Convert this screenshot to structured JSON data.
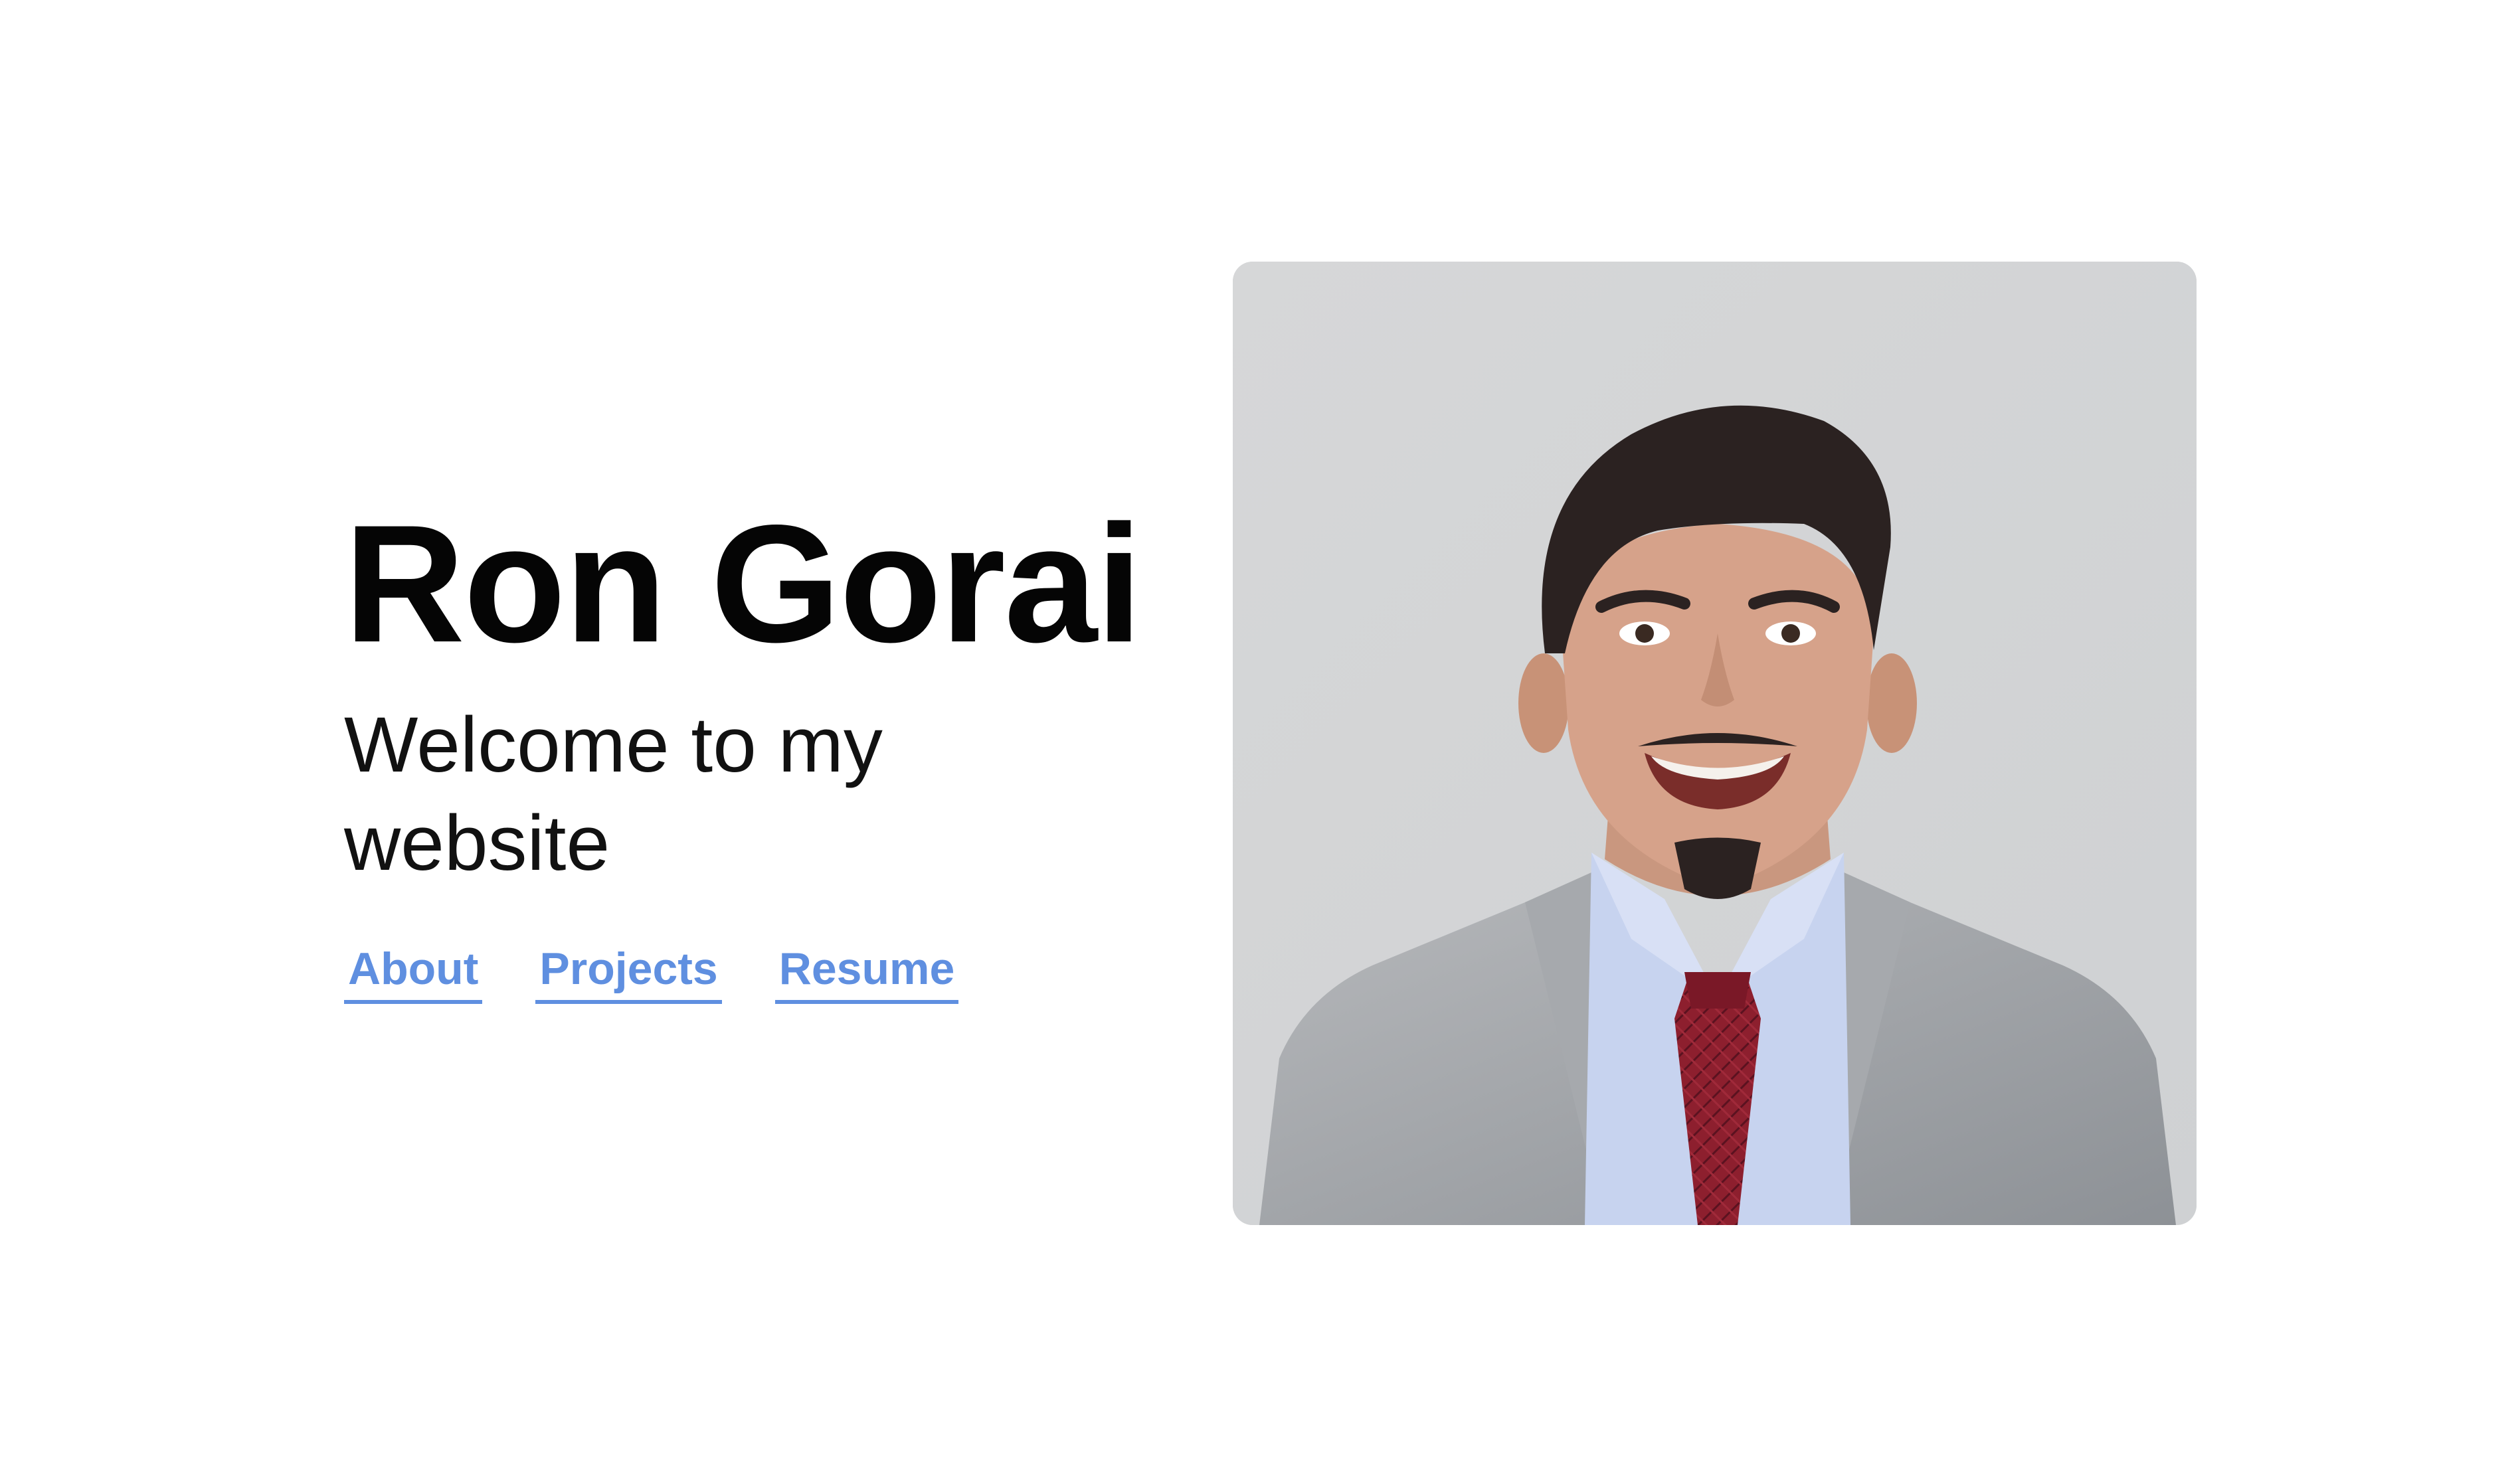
{
  "hero": {
    "name": "Ron Gorai",
    "tagline": "Welcome to my website"
  },
  "nav": {
    "links": [
      {
        "label": "About"
      },
      {
        "label": "Projects"
      },
      {
        "label": "Resume"
      }
    ]
  },
  "colors": {
    "background": "#ffffff",
    "title": "#050505",
    "link": "#5f8fe0",
    "photo_background": "#d3d5d6",
    "suit": "#9fa3a8",
    "shirt": "#c7d3ef",
    "tie": "#8d1f2e"
  }
}
